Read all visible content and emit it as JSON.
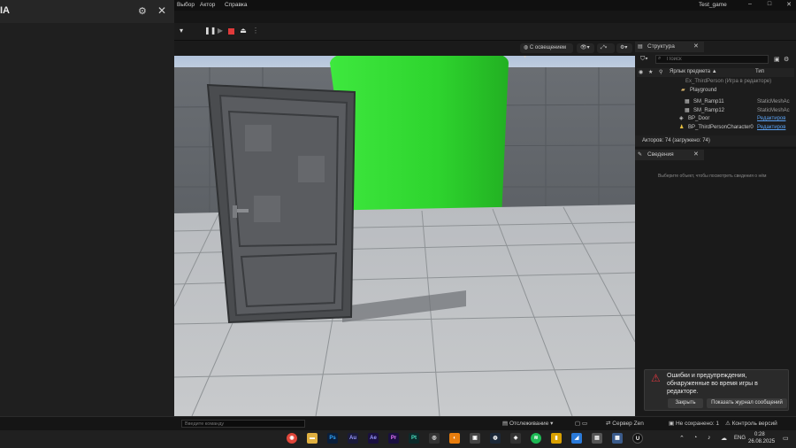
{
  "app": {
    "title": "Test_game",
    "left_title_fragment": "IA",
    "menus": [
      "Выбор",
      "Актор",
      "Справка"
    ],
    "window_controls": [
      "–",
      "□",
      "✕"
    ]
  },
  "viewport": {
    "lighting_mode": "С освещением"
  },
  "outliner": {
    "tab_label": "Структура",
    "search_placeholder": "Поиск",
    "col_label": "Ярлык предмета ▲",
    "col_type": "Тип",
    "rows": [
      {
        "label": "Ex_ThirdPerson (Игра в редакторе)",
        "type": ""
      },
      {
        "label": "Playground",
        "type": ""
      },
      {
        "label": "SM_Ramp11",
        "type": "StaticMeshAc"
      },
      {
        "label": "SM_Ramp12",
        "type": "StaticMeshAc"
      },
      {
        "label": "BP_Door",
        "type": "Редактиров"
      },
      {
        "label": "BP_ThirdPersonCharacter0",
        "type": "Редактиров"
      }
    ],
    "actor_count": "Акторов: 74 (загружено: 74)"
  },
  "details": {
    "tab_label": "Сведения",
    "empty_message": "Выберите объект, чтобы посмотреть сведения о нём"
  },
  "notification": {
    "message": "Ошибки и предупреждения, обнаруженные во время игры в редакторе.",
    "close_label": "Закрыть",
    "show_log_label": "Показать журнал сообщений"
  },
  "statusbar": {
    "console_placeholder": "Введите команду",
    "tracking": "Отслеживание",
    "server": "Сервер Zen",
    "unsaved": "Не сохранено: 1",
    "version_control": "Контроль версий"
  },
  "taskbar": {
    "lang": "ENG",
    "time": "0:28",
    "date": "26.08.2025",
    "apps": [
      "Ps",
      "Au",
      "Ae",
      "Pr",
      "Pt"
    ]
  },
  "colors": {
    "accent_green": "#2fd82f",
    "error_red": "#d9363e",
    "folder_yellow": "#d9b56b",
    "link_blue": "#5aa0f0"
  }
}
